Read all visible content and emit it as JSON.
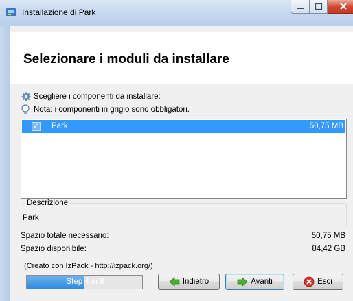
{
  "window": {
    "title": "Installazione di  Park"
  },
  "header": {
    "title": "Selezionare i moduli da installare"
  },
  "info": {
    "choose_text": "Scegliere i componenti da installare:",
    "note_text": "Nota: i componenti in grigio sono obbligatori."
  },
  "packs": [
    {
      "name": "Park",
      "size": "50,75 MB",
      "checked": true,
      "selected": true
    }
  ],
  "description": {
    "legend": "Descrizione",
    "value": "Park"
  },
  "space": {
    "required_label": "Spazio totale necessario:",
    "required_value": "50,75 MB",
    "available_label": "Spazio disponibile:",
    "available_value": "84,42 GB"
  },
  "footer": {
    "credit": "(Creato con IzPack - http://izpack.org/)"
  },
  "progress": {
    "label": "Step 4 di 8",
    "step": 4,
    "total": 8
  },
  "buttons": {
    "back": "Indietro",
    "next": "Avanti",
    "quit": "Esci"
  },
  "colors": {
    "selection": "#3399ff",
    "progress": "#2f8be0",
    "title_bar": "#c4d7ee"
  },
  "icons": {
    "app": "installer-icon",
    "choose": "gear-icon",
    "note": "lightbulb-icon",
    "back": "arrow-left-icon",
    "next": "arrow-right-icon",
    "quit": "close-circle-icon"
  }
}
